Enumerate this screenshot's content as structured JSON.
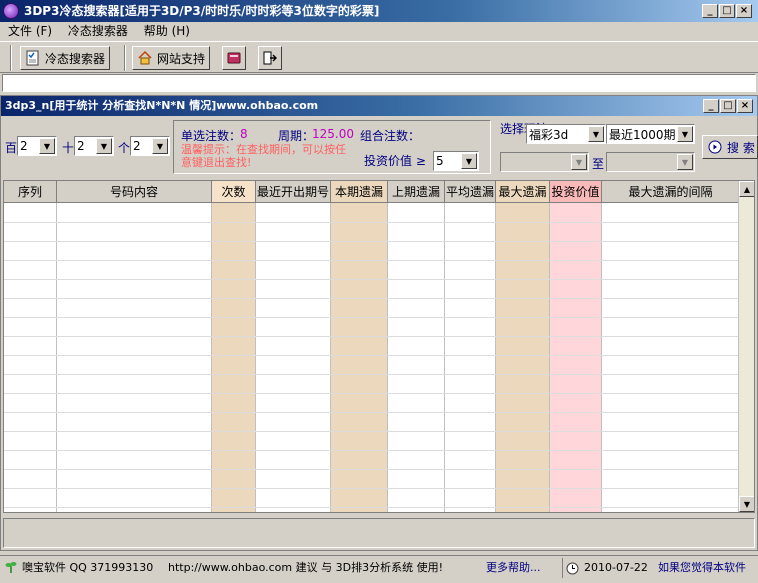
{
  "window": {
    "title": "3DP3冷态搜索器[适用于3D/P3/时时乐/时时彩等3位数字的彩票]",
    "min_label": "_",
    "max_label": "□",
    "close_label": "×"
  },
  "menu": {
    "items": [
      {
        "label": "文件 (F)"
      },
      {
        "label": "冷态搜索器"
      },
      {
        "label": "帮助 (H)"
      }
    ]
  },
  "toolbar": {
    "cold_search_label": "冷态搜索器",
    "site_support_label": "网站支持"
  },
  "child_window": {
    "title": "3dp3_n[用于统计 分析查找N*N*N 情况]www.ohbao.com"
  },
  "filters": {
    "hundreds": {
      "label": "百",
      "value": "2"
    },
    "tens": {
      "label": "十",
      "value": "2"
    },
    "ones": {
      "label": "个",
      "value": "2"
    },
    "single_count_label": "单选注数：",
    "single_count_value": "8",
    "period_label": "周期：",
    "period_value": "125.00",
    "combo_count_label": "组合注数：",
    "hint": "温馨提示：在查找期间，可以按任意键退出查找!",
    "invest_label": "投资价值 ≥",
    "invest_value": "5",
    "play_label": "选择玩法",
    "play_value": "福彩3d",
    "range_value": "最近1000期",
    "to_label": "至",
    "search_label": "搜 索"
  },
  "table": {
    "columns": [
      "序列",
      "号码内容",
      "次数",
      "最近开出期号",
      "本期遗漏",
      "上期遗漏",
      "平均遗漏",
      "最大遗漏",
      "投资价值",
      "最大遗漏的间隔"
    ],
    "rows": []
  },
  "status": {
    "company": "噢宝软件 QQ 371993130",
    "url_note": "http://www.ohbao.com 建议 与 3D排3分析系统 使用!",
    "more_help": "更多帮助...",
    "date": "2010-07-22",
    "promo": "如果您觉得本软件"
  },
  "colors": {
    "title_gradient_start": "#0a246a",
    "title_gradient_end": "#a6caf0",
    "toolbar_bg": "#d4d0c8",
    "col_tan": "#ebd8bd",
    "col_pink": "#ffd6d9",
    "accent_purple": "#c000c0",
    "hint_red": "#ff6060",
    "label_blue": "#000080"
  }
}
